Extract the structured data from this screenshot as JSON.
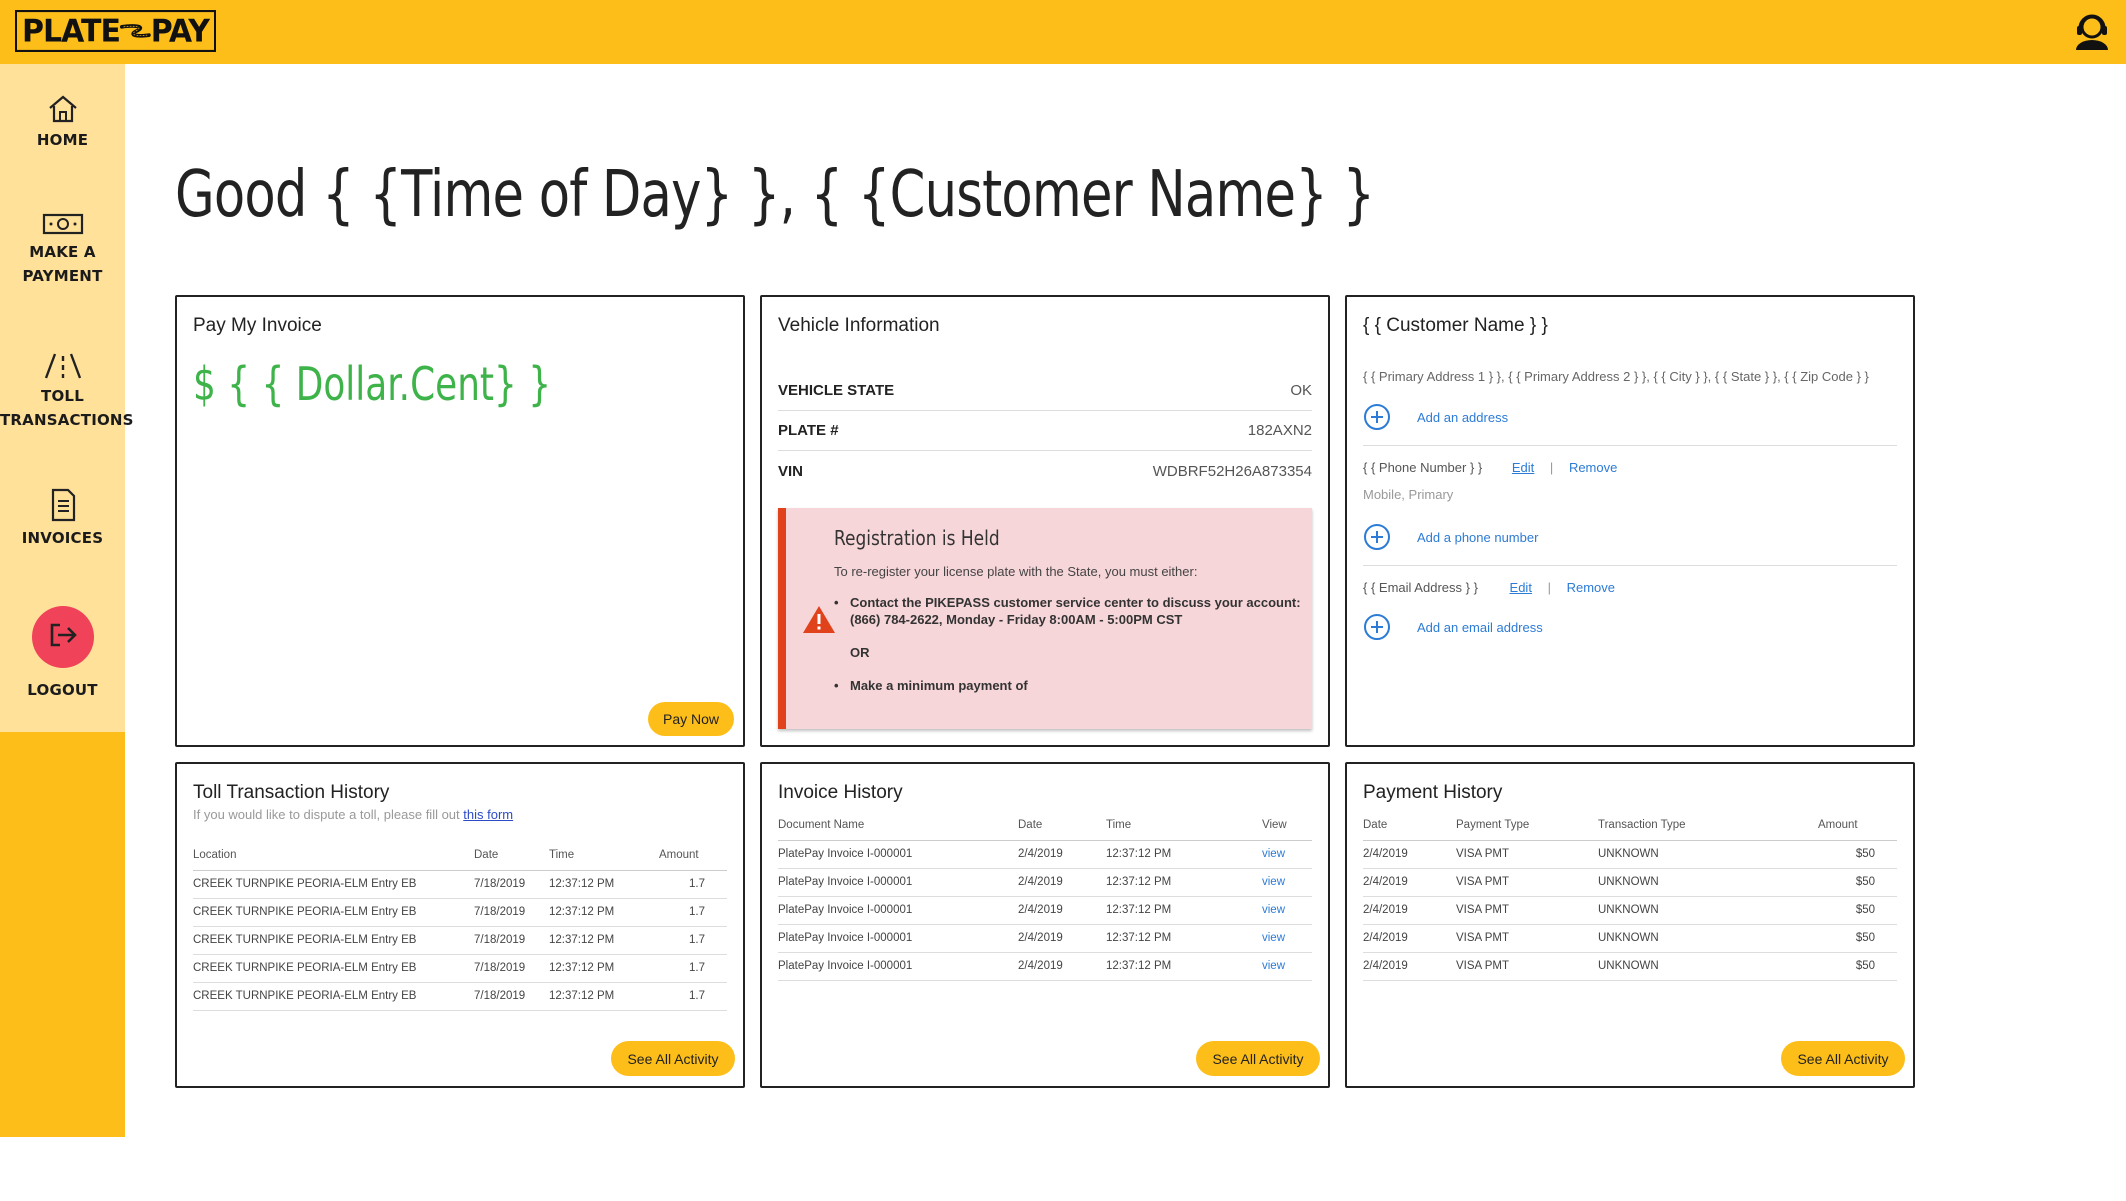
{
  "brand": {
    "logo_left": "PLATE",
    "logo_right": "PAY",
    "accent": "#FDBE1A",
    "sidebar_light": "#FFE199",
    "logout_color": "#F0435A",
    "amount_color": "#3DB34A",
    "link_color": "#2C7BD6"
  },
  "header": {
    "profile_icon": "support-agent-icon"
  },
  "sidebar": {
    "items": [
      {
        "label": "HOME",
        "icon": "home-icon"
      },
      {
        "label_line1": "MAKE A",
        "label_line2": "PAYMENT",
        "icon": "cash-icon"
      },
      {
        "label_line1": "TOLL",
        "label_line2": "TRANSACTIONS",
        "icon": "road-icon"
      },
      {
        "label": "INVOICES",
        "icon": "document-icon"
      },
      {
        "label": "LOGOUT",
        "icon": "logout-icon"
      }
    ]
  },
  "greeting": "Good { {Time of Day} }, { {Customer Name} }",
  "pay_invoice": {
    "title": "Pay My Invoice",
    "amount": "$ { { Dollar.Cent} }",
    "button": "Pay Now"
  },
  "vehicle": {
    "title": "Vehicle Information",
    "rows": [
      {
        "label": "VEHICLE STATE",
        "value": "OK"
      },
      {
        "label": "PLATE #",
        "value": "182AXN2"
      },
      {
        "label": "VIN",
        "value": "WDBRF52H26A873354"
      }
    ],
    "alert": {
      "title": "Registration is Held",
      "subtitle": "To re-register your license plate with the State, you must either:",
      "item1": "Contact the PIKEPASS customer service center to discuss your account: (866) 784-2622, Monday - Friday 8:00AM - 5:00PM CST",
      "or": "OR",
      "item2": "Make a minimum payment of"
    }
  },
  "customer": {
    "title": "{ { Customer Name } }",
    "address": "{ { Primary Address 1 } }, { { Primary Address 2 } }, { { City } }, { { State } }, { { Zip Code } }",
    "add_address": "Add an address",
    "phone": "{ { Phone Number } }",
    "phone_sub": "Mobile, Primary",
    "edit": "Edit",
    "remove": "Remove",
    "separator": "|",
    "add_phone": "Add a phone number",
    "email": "{ { Email Address } }",
    "add_email": "Add an email address"
  },
  "toll_history": {
    "title": "Toll Transaction History",
    "subtext": "If you would like to dispute a toll, please fill out",
    "subtext_link": "this form",
    "columns": [
      "Location",
      "Date",
      "Time",
      "Amount"
    ],
    "rows": [
      [
        "CREEK TURNPIKE PEORIA-ELM Entry EB",
        "7/18/2019",
        "12:37:12 PM",
        "1.7"
      ],
      [
        "CREEK TURNPIKE PEORIA-ELM Entry EB",
        "7/18/2019",
        "12:37:12 PM",
        "1.7"
      ],
      [
        "CREEK TURNPIKE PEORIA-ELM Entry EB",
        "7/18/2019",
        "12:37:12 PM",
        "1.7"
      ],
      [
        "CREEK TURNPIKE PEORIA-ELM Entry EB",
        "7/18/2019",
        "12:37:12 PM",
        "1.7"
      ],
      [
        "CREEK TURNPIKE PEORIA-ELM Entry EB",
        "7/18/2019",
        "12:37:12 PM",
        "1.7"
      ]
    ],
    "button": "See All Activity"
  },
  "invoice_history": {
    "title": "Invoice History",
    "columns": [
      "Document Name",
      "Date",
      "Time",
      "View"
    ],
    "rows": [
      [
        "PlatePay Invoice I-000001",
        "2/4/2019",
        "12:37:12 PM",
        "view"
      ],
      [
        "PlatePay Invoice I-000001",
        "2/4/2019",
        "12:37:12 PM",
        "view"
      ],
      [
        "PlatePay Invoice I-000001",
        "2/4/2019",
        "12:37:12 PM",
        "view"
      ],
      [
        "PlatePay Invoice I-000001",
        "2/4/2019",
        "12:37:12 PM",
        "view"
      ],
      [
        "PlatePay Invoice I-000001",
        "2/4/2019",
        "12:37:12 PM",
        "view"
      ]
    ],
    "button": "See All Activity"
  },
  "payment_history": {
    "title": "Payment History",
    "columns": [
      "Date",
      "Payment Type",
      "Transaction Type",
      "Amount"
    ],
    "rows": [
      [
        "2/4/2019",
        "VISA PMT",
        "UNKNOWN",
        "$50"
      ],
      [
        "2/4/2019",
        "VISA PMT",
        "UNKNOWN",
        "$50"
      ],
      [
        "2/4/2019",
        "VISA PMT",
        "UNKNOWN",
        "$50"
      ],
      [
        "2/4/2019",
        "VISA PMT",
        "UNKNOWN",
        "$50"
      ],
      [
        "2/4/2019",
        "VISA PMT",
        "UNKNOWN",
        "$50"
      ]
    ],
    "button": "See All Activity"
  }
}
